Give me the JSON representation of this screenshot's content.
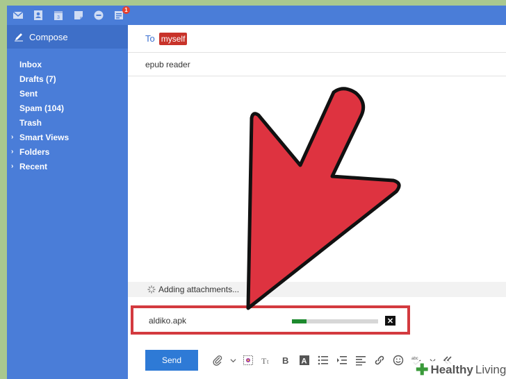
{
  "topbar": {
    "icons": [
      "mail-icon",
      "contacts-icon",
      "calendar-icon",
      "notepad-icon",
      "messenger-icon",
      "news-icon"
    ],
    "news_badge": "1"
  },
  "sidebar": {
    "compose_label": "Compose",
    "items": [
      {
        "label": "Inbox",
        "expandable": false
      },
      {
        "label": "Drafts (7)",
        "expandable": false
      },
      {
        "label": "Sent",
        "expandable": false
      },
      {
        "label": "Spam (104)",
        "expandable": false
      },
      {
        "label": "Trash",
        "expandable": false
      },
      {
        "label": "Smart Views",
        "expandable": true
      },
      {
        "label": "Folders",
        "expandable": true
      },
      {
        "label": "Recent",
        "expandable": true
      }
    ]
  },
  "compose": {
    "to_label": "To",
    "recipient": "myself",
    "subject": "epub reader",
    "status": "Adding attachments...",
    "attachment": {
      "name": "aldiko.apk",
      "progress": 0.17,
      "remove_label": "✕"
    },
    "send_label": "Send"
  },
  "watermark": {
    "word1": "Healthy",
    "word2": "Living"
  },
  "colors": {
    "app_blue": "#4a7dd8",
    "arrow_red": "#de3340",
    "highlight_red": "#d33a3f",
    "progress_green": "#1d8a2e",
    "background_green": "#a9c88f"
  }
}
